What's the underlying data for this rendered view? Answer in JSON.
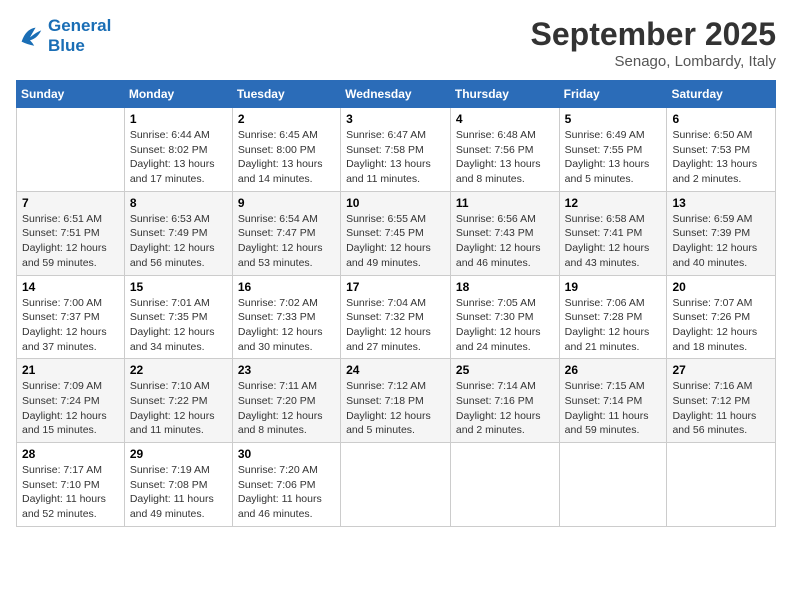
{
  "header": {
    "logo_line1": "General",
    "logo_line2": "Blue",
    "month": "September 2025",
    "location": "Senago, Lombardy, Italy"
  },
  "weekdays": [
    "Sunday",
    "Monday",
    "Tuesday",
    "Wednesday",
    "Thursday",
    "Friday",
    "Saturday"
  ],
  "weeks": [
    [
      {
        "day": "",
        "info": ""
      },
      {
        "day": "1",
        "info": "Sunrise: 6:44 AM\nSunset: 8:02 PM\nDaylight: 13 hours and 17 minutes."
      },
      {
        "day": "2",
        "info": "Sunrise: 6:45 AM\nSunset: 8:00 PM\nDaylight: 13 hours and 14 minutes."
      },
      {
        "day": "3",
        "info": "Sunrise: 6:47 AM\nSunset: 7:58 PM\nDaylight: 13 hours and 11 minutes."
      },
      {
        "day": "4",
        "info": "Sunrise: 6:48 AM\nSunset: 7:56 PM\nDaylight: 13 hours and 8 minutes."
      },
      {
        "day": "5",
        "info": "Sunrise: 6:49 AM\nSunset: 7:55 PM\nDaylight: 13 hours and 5 minutes."
      },
      {
        "day": "6",
        "info": "Sunrise: 6:50 AM\nSunset: 7:53 PM\nDaylight: 13 hours and 2 minutes."
      }
    ],
    [
      {
        "day": "7",
        "info": "Sunrise: 6:51 AM\nSunset: 7:51 PM\nDaylight: 12 hours and 59 minutes."
      },
      {
        "day": "8",
        "info": "Sunrise: 6:53 AM\nSunset: 7:49 PM\nDaylight: 12 hours and 56 minutes."
      },
      {
        "day": "9",
        "info": "Sunrise: 6:54 AM\nSunset: 7:47 PM\nDaylight: 12 hours and 53 minutes."
      },
      {
        "day": "10",
        "info": "Sunrise: 6:55 AM\nSunset: 7:45 PM\nDaylight: 12 hours and 49 minutes."
      },
      {
        "day": "11",
        "info": "Sunrise: 6:56 AM\nSunset: 7:43 PM\nDaylight: 12 hours and 46 minutes."
      },
      {
        "day": "12",
        "info": "Sunrise: 6:58 AM\nSunset: 7:41 PM\nDaylight: 12 hours and 43 minutes."
      },
      {
        "day": "13",
        "info": "Sunrise: 6:59 AM\nSunset: 7:39 PM\nDaylight: 12 hours and 40 minutes."
      }
    ],
    [
      {
        "day": "14",
        "info": "Sunrise: 7:00 AM\nSunset: 7:37 PM\nDaylight: 12 hours and 37 minutes."
      },
      {
        "day": "15",
        "info": "Sunrise: 7:01 AM\nSunset: 7:35 PM\nDaylight: 12 hours and 34 minutes."
      },
      {
        "day": "16",
        "info": "Sunrise: 7:02 AM\nSunset: 7:33 PM\nDaylight: 12 hours and 30 minutes."
      },
      {
        "day": "17",
        "info": "Sunrise: 7:04 AM\nSunset: 7:32 PM\nDaylight: 12 hours and 27 minutes."
      },
      {
        "day": "18",
        "info": "Sunrise: 7:05 AM\nSunset: 7:30 PM\nDaylight: 12 hours and 24 minutes."
      },
      {
        "day": "19",
        "info": "Sunrise: 7:06 AM\nSunset: 7:28 PM\nDaylight: 12 hours and 21 minutes."
      },
      {
        "day": "20",
        "info": "Sunrise: 7:07 AM\nSunset: 7:26 PM\nDaylight: 12 hours and 18 minutes."
      }
    ],
    [
      {
        "day": "21",
        "info": "Sunrise: 7:09 AM\nSunset: 7:24 PM\nDaylight: 12 hours and 15 minutes."
      },
      {
        "day": "22",
        "info": "Sunrise: 7:10 AM\nSunset: 7:22 PM\nDaylight: 12 hours and 11 minutes."
      },
      {
        "day": "23",
        "info": "Sunrise: 7:11 AM\nSunset: 7:20 PM\nDaylight: 12 hours and 8 minutes."
      },
      {
        "day": "24",
        "info": "Sunrise: 7:12 AM\nSunset: 7:18 PM\nDaylight: 12 hours and 5 minutes."
      },
      {
        "day": "25",
        "info": "Sunrise: 7:14 AM\nSunset: 7:16 PM\nDaylight: 12 hours and 2 minutes."
      },
      {
        "day": "26",
        "info": "Sunrise: 7:15 AM\nSunset: 7:14 PM\nDaylight: 11 hours and 59 minutes."
      },
      {
        "day": "27",
        "info": "Sunrise: 7:16 AM\nSunset: 7:12 PM\nDaylight: 11 hours and 56 minutes."
      }
    ],
    [
      {
        "day": "28",
        "info": "Sunrise: 7:17 AM\nSunset: 7:10 PM\nDaylight: 11 hours and 52 minutes."
      },
      {
        "day": "29",
        "info": "Sunrise: 7:19 AM\nSunset: 7:08 PM\nDaylight: 11 hours and 49 minutes."
      },
      {
        "day": "30",
        "info": "Sunrise: 7:20 AM\nSunset: 7:06 PM\nDaylight: 11 hours and 46 minutes."
      },
      {
        "day": "",
        "info": ""
      },
      {
        "day": "",
        "info": ""
      },
      {
        "day": "",
        "info": ""
      },
      {
        "day": "",
        "info": ""
      }
    ]
  ]
}
